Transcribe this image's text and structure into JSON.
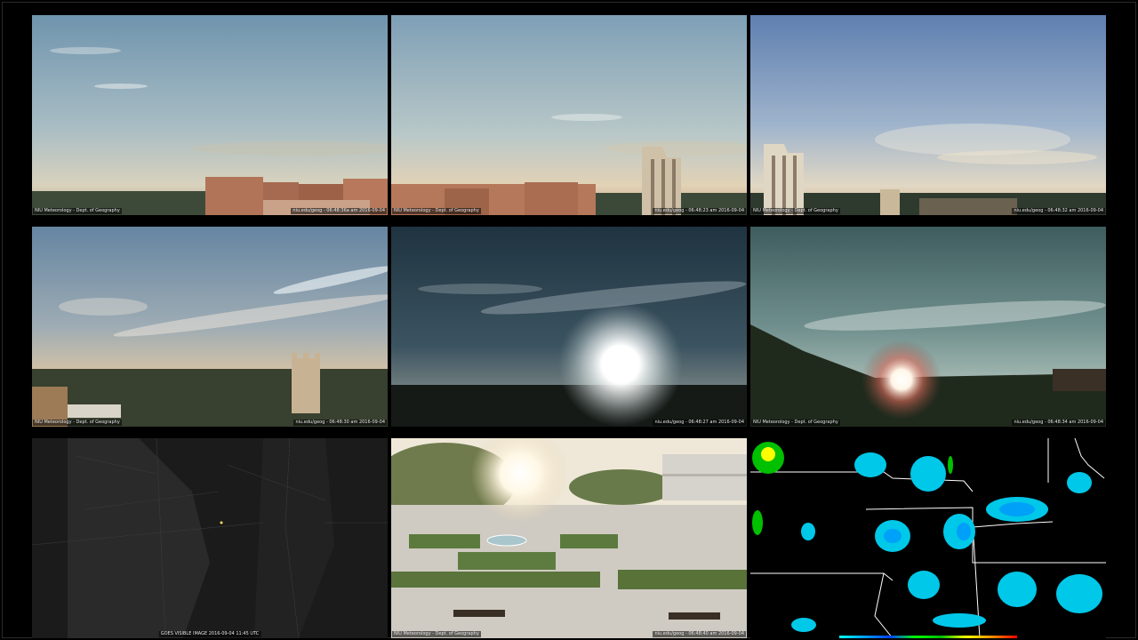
{
  "colors": {
    "background": "#000000",
    "sky_top": "#6f8fa8",
    "sky_horizon": "#e7c9a0",
    "building": "#b9785a",
    "radar_green": "#00c000",
    "radar_cyan": "#00e0ff",
    "radar_yellow": "#ffff00"
  },
  "panels": [
    {
      "caption_left": "NIU Meteorology - Dept. of Geography",
      "caption_right": "niu.edu/geog - 06:48:36a am 2016-09-04"
    },
    {
      "caption_left": "NIU Meteorology - Dept. of Geography",
      "caption_right": "niu.edu/geog - 06:48:23 am 2016-09-04"
    },
    {
      "caption_left": "NIU Meteorology - Dept. of Geography",
      "caption_right": "niu.edu/geog - 06:48:32 am 2016-09-04"
    },
    {
      "caption_left": "NIU Meteorology - Dept. of Geography",
      "caption_right": "niu.edu/geog - 06:48:30 am 2016-09-04"
    },
    {
      "caption_left": "",
      "caption_right": "niu.edu/geog - 06:48:27 am 2016-09-04"
    },
    {
      "caption_left": "NIU Meteorology - Dept. of Geography",
      "caption_right": "niu.edu/geog - 06:48:34 am 2016-09-04"
    },
    {
      "caption_center": "GOES VISIBLE IMAGE 2016-09-04 11:45 UTC"
    },
    {
      "caption_left": "NIU Meteorology - Dept. of Geography",
      "caption_right": "niu.edu/geog - 06:48:40 am 2016-09-04"
    },
    {
      "caption_center": ""
    }
  ]
}
